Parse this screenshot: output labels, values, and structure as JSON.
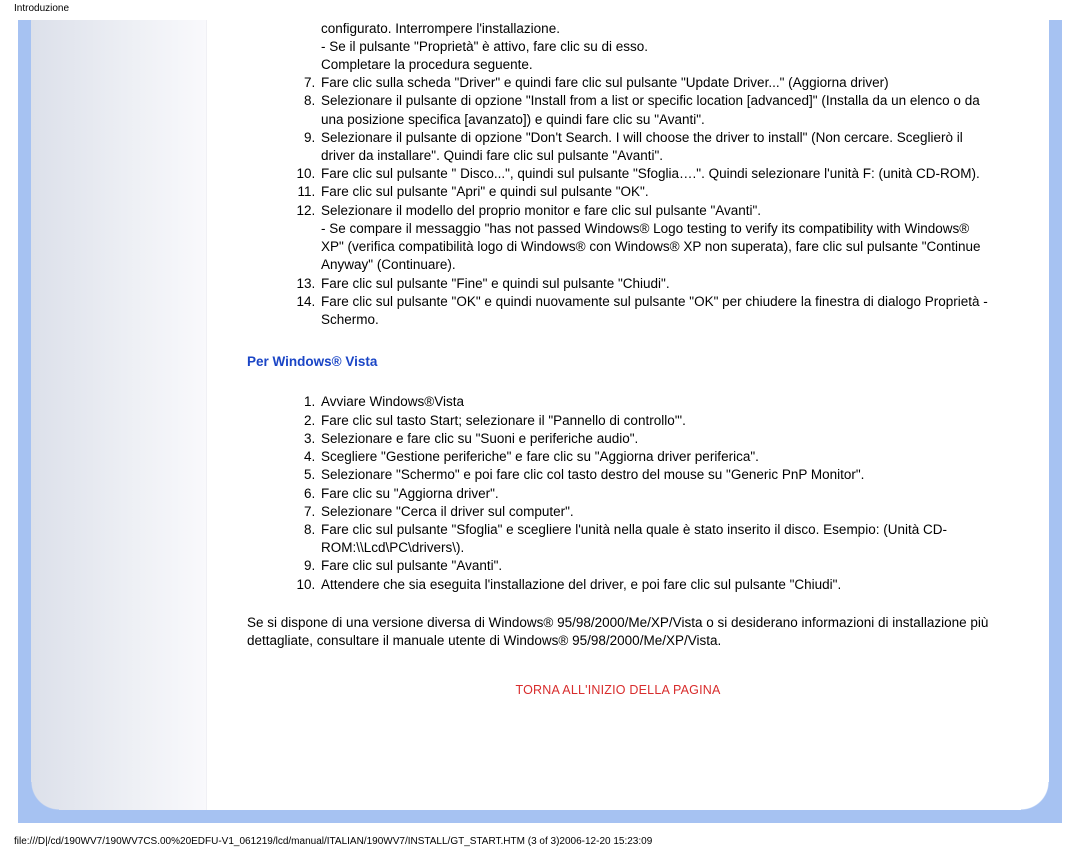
{
  "page_title": "Introduzione",
  "xp_list_start": 7,
  "xp_steps_pre": [
    "configurato. Interrompere l'installazione.\n- Se il pulsante \"Proprietà\" è attivo, fare clic su di esso.\nCompletare la procedura seguente.",
    "Fare clic sulla scheda \"Driver\" e quindi fare clic sul pulsante \"Update Driver...\" (Aggiorna driver)",
    "Selezionare il pulsante di opzione \"Install from a list or specific location [advanced]\" (Installa da un elenco o da una posizione specifica [avanzato]) e quindi fare clic su \"Avanti\".",
    "Selezionare il pulsante di opzione \"Don't Search. I will choose the driver to install\" (Non cercare. Sceglierò il driver da installare\". Quindi fare clic sul pulsante \"Avanti\".",
    "Fare clic sul pulsante \" Disco...\", quindi sul pulsante \"Sfoglia….\". Quindi selezionare l'unità F: (unità CD-ROM).",
    "Fare clic sul pulsante \"Apri\" e quindi sul pulsante \"OK\".",
    "Selezionare il modello del proprio monitor e fare clic sul pulsante \"Avanti\".\n- Se compare il messaggio \"has not passed Windows® Logo testing to verify its compatibility with Windows® XP\" (verifica compatibilità logo di Windows® con Windows® XP non superata), fare clic sul pulsante \"Continue Anyway\" (Continuare).",
    "Fare clic sul pulsante \"Fine\" e quindi sul pulsante \"Chiudi\".",
    "Fare clic sul pulsante \"OK\" e quindi nuovamente sul pulsante \"OK\" per chiudere la finestra di dialogo Proprietà - Schermo."
  ],
  "vista_heading": "Per Windows® Vista",
  "vista_steps": [
    "Avviare Windows®Vista",
    "Fare clic sul tasto Start; selezionare il \"Pannello di controllo'\".",
    "Selezionare e fare clic su \"Suoni e periferiche audio\".",
    "Scegliere \"Gestione periferiche\" e fare clic su \"Aggiorna driver periferica\".",
    "Selezionare \"Schermo\" e poi fare clic col tasto destro del mouse su \"Generic PnP Monitor\".",
    "Fare clic su \"Aggiorna driver\".",
    "Selezionare \"Cerca il driver sul computer\".",
    "Fare clic sul pulsante \"Sfoglia\" e scegliere l'unità nella quale è stato inserito il disco. Esempio: (Unità CD-ROM:\\\\Lcd\\PC\\drivers\\).",
    "Fare clic sul pulsante \"Avanti\".",
    "Attendere che sia eseguita l'installazione del driver, e poi fare clic sul pulsante \"Chiudi\"."
  ],
  "note": "Se si dispone di una versione diversa di Windows® 95/98/2000/Me/XP/Vista o si desiderano informazioni di installazione più dettagliate, consultare il manuale utente di Windows® 95/98/2000/Me/XP/Vista.",
  "back_to_top": "TORNA ALL'INIZIO DELLA PAGINA",
  "footer_url": "file:///D|/cd/190WV7/190WV7CS.00%20EDFU-V1_061219/lcd/manual/ITALIAN/190WV7/INSTALL/GT_START.HTM (3 of 3)2006-12-20 15:23:09"
}
